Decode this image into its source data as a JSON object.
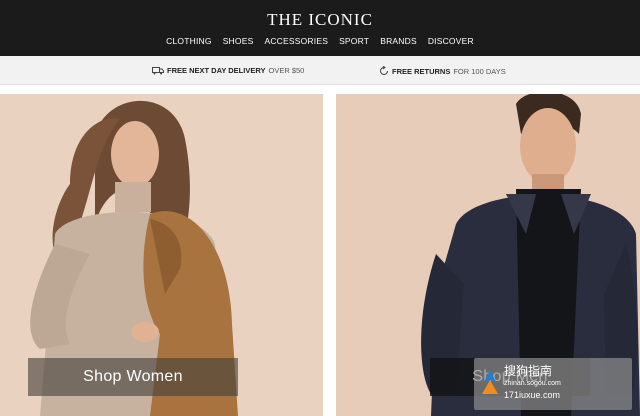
{
  "header": {
    "logo": "THE ICONIC",
    "nav": [
      "CLOTHING",
      "SHOES",
      "ACCESSORIES",
      "SPORT",
      "BRANDS",
      "DISCOVER"
    ]
  },
  "promo": {
    "delivery_bold": "FREE NEXT DAY DELIVERY",
    "delivery_thin": "OVER $50",
    "returns_bold": "FREE RETURNS",
    "returns_thin": "FOR 100 DAYS"
  },
  "hero": {
    "women_button": "Shop Women",
    "men_button": "Shop Men"
  },
  "watermark": {
    "title": "搜狗指南",
    "domain": "zhinan.sogou.com",
    "domain2": "171iuxue.com"
  },
  "colors": {
    "header_bg": "#1b1b1b",
    "promo_bg": "#f2f2f2",
    "women_panel_bg": "#e9d2bf",
    "men_panel_bg": "#e7cdb9"
  }
}
